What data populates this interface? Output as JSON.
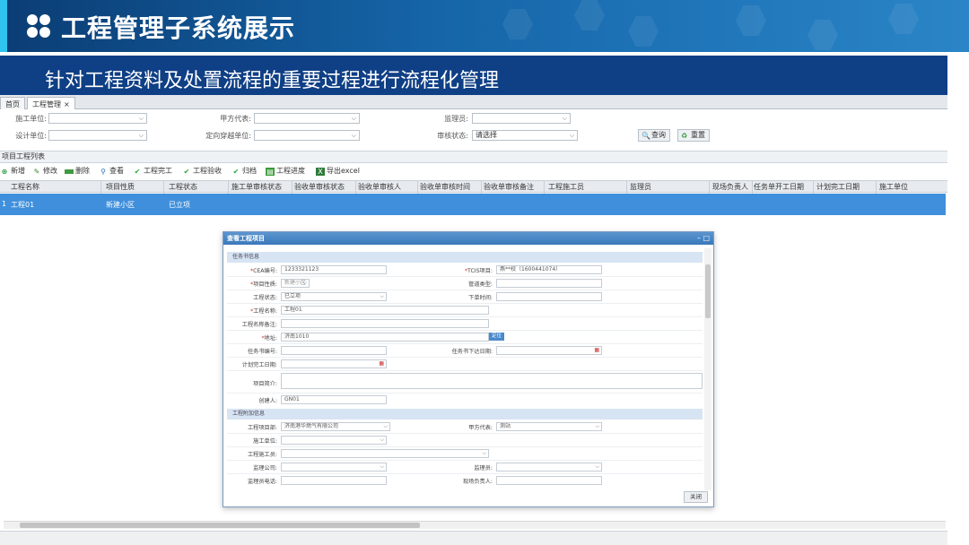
{
  "slide": {
    "title": "工程管理子系统展示",
    "subtitle": "针对工程资料及处置流程的重要过程进行流程化管理"
  },
  "tabs": [
    {
      "label": "首页"
    },
    {
      "label": "工程管理",
      "close": "×"
    }
  ],
  "filters": {
    "construction_unit": "施工单位:",
    "client_rep": "甲方代表:",
    "supervisor": "监理员:",
    "design_unit": "设计单位:",
    "directional_unit": "定向穿越单位:",
    "review_status": "审核状态:",
    "review_status_value": "请选择",
    "query_button": "查询",
    "reset_button": "重置"
  },
  "list_title": "项目工程列表",
  "toolbar": [
    {
      "label": "新增",
      "icon": "plus-icon"
    },
    {
      "label": "修改",
      "icon": "pencil-icon"
    },
    {
      "label": "删除",
      "icon": "delete-icon"
    },
    {
      "label": "查看",
      "icon": "search-icon"
    },
    {
      "label": "工程完工",
      "icon": "check-icon"
    },
    {
      "label": "工程验收",
      "icon": "check-icon"
    },
    {
      "label": "归档",
      "icon": "check-icon"
    },
    {
      "label": "工程进度",
      "icon": "progress-icon"
    },
    {
      "label": "导出excel",
      "icon": "excel-icon"
    }
  ],
  "table": {
    "columns": [
      "工程名称",
      "项目性质",
      "工程状态",
      "施工单审核状态",
      "验收单审核状态",
      "验收单审核人",
      "验收单审核时间",
      "验收单审核备注",
      "工程施工员",
      "监理员",
      "现场负责人",
      "任务单开工日期",
      "计划完工日期",
      "施工单位"
    ],
    "rows": [
      {
        "index": "1",
        "name": "工程01",
        "nature": "新建小区",
        "status": "已立项"
      }
    ]
  },
  "dialog": {
    "title": "查看工程项目",
    "section_task": "任务书信息",
    "section_extra": "工程附加信息",
    "close_button": "关闭",
    "fields": {
      "cea_no_label": "CEA编号:",
      "cea_no": "1233321123",
      "tcis_label": "TCIS项目:",
      "tcis": "燕**校（1600441074）",
      "nature_label": "项目性质:",
      "nature": "新建小区",
      "pipe_type_label": "管道类型:",
      "pipe_type": "",
      "status_label": "工程状态:",
      "status": "已立项",
      "issue_time_label": "下单时间:",
      "issue_time": "",
      "name_label": "工程名称:",
      "name": "工程01",
      "name_note_label": "工程名称备注:",
      "name_note": "",
      "address_label": "地址:",
      "address": "济南1010",
      "locate_button": "定位",
      "task_no_label": "任务书编号:",
      "task_no": "",
      "task_date_label": "任务书下达日期:",
      "task_date": "",
      "plan_finish_label": "计划完工日期:",
      "plan_finish": "",
      "project_desc_label": "项目简介:",
      "project_desc": "",
      "creator_label": "创建人:",
      "creator": "GN01",
      "manager_label": "工程项目部:",
      "manager": "济南港华燃气有限公司",
      "client_rep_label": "甲方代表:",
      "client_rep": "测站",
      "construction_unit_label": "施工单位:",
      "construction_unit": "",
      "worker_label": "工程施工员:",
      "worker": "",
      "supervise_co_label": "监理公司:",
      "supervise_co": "",
      "supervisor_label": "监理员:",
      "supervisor": "",
      "supervisor_phone_label": "监理员电话:",
      "supervisor_phone": "",
      "site_manager_label": "现场负责人:",
      "site_manager": ""
    }
  }
}
